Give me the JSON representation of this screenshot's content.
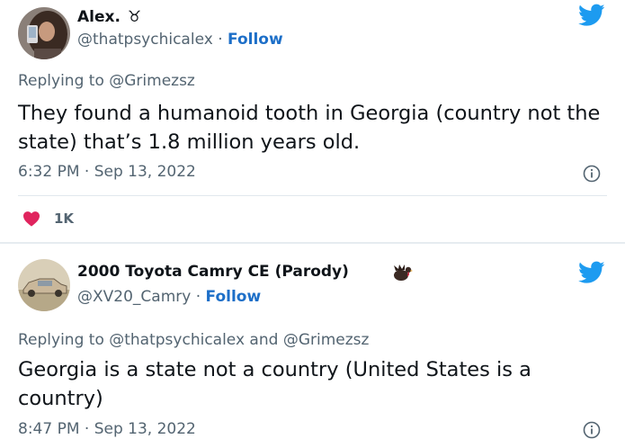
{
  "colors": {
    "accent": "#1d9bf0",
    "follow": "#1d6fc8",
    "heart": "#e0245e",
    "muted": "#536471"
  },
  "tweets": [
    {
      "author_name": "Alex.",
      "name_glyph": "♉︎",
      "handle": "@thatpsychicalex",
      "dot": "·",
      "follow_label": "Follow",
      "replying_to": "Replying to @Grimezsz",
      "text": "They found a humanoid tooth in Georgia (country not the state) that’s 1.8 million years old.",
      "time": "6:32 PM · Sep 13, 2022",
      "likes": "1K",
      "icons": {
        "brand": "twitter-bird-icon",
        "info": "info-icon",
        "like": "heart-icon"
      }
    },
    {
      "author_name": "2000 Toyota Camry CE (Parody)",
      "handle": "@XV20_Camry",
      "dot": "·",
      "follow_label": "Follow",
      "replying_to": "Replying to @thatpsychicalex and @Grimezsz",
      "text": "Georgia is a state not a country (United States is a country)",
      "time": "8:47 PM · Sep 13, 2022",
      "icons": {
        "brand": "twitter-bird-icon",
        "info": "info-icon",
        "badge": "turkey-emoji-icon"
      }
    }
  ]
}
